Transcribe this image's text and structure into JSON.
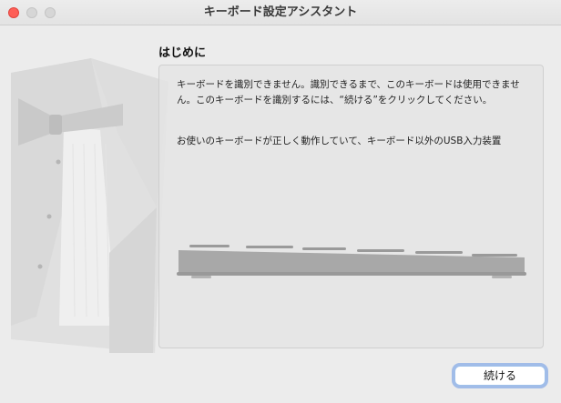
{
  "window": {
    "title": "キーボード設定アシスタント",
    "controls": [
      "close",
      "minimize",
      "zoom"
    ]
  },
  "section": {
    "heading": "はじめに"
  },
  "content": {
    "paragraph1": "キーボードを識別できません。識別できるまで、このキーボードは使用できません。このキーボードを識別するには、“続ける”をクリックしてください。",
    "paragraph2": "お使いのキーボードが正しく動作していて、キーボード以外のUSB入力装置"
  },
  "illustrations": {
    "background": "tuxedo-image",
    "keyboard": "keyboard-icon"
  },
  "buttons": {
    "continue_label": "続ける"
  },
  "colors": {
    "close_button": "#fe5f57",
    "focus_ring": "#6496e6"
  }
}
